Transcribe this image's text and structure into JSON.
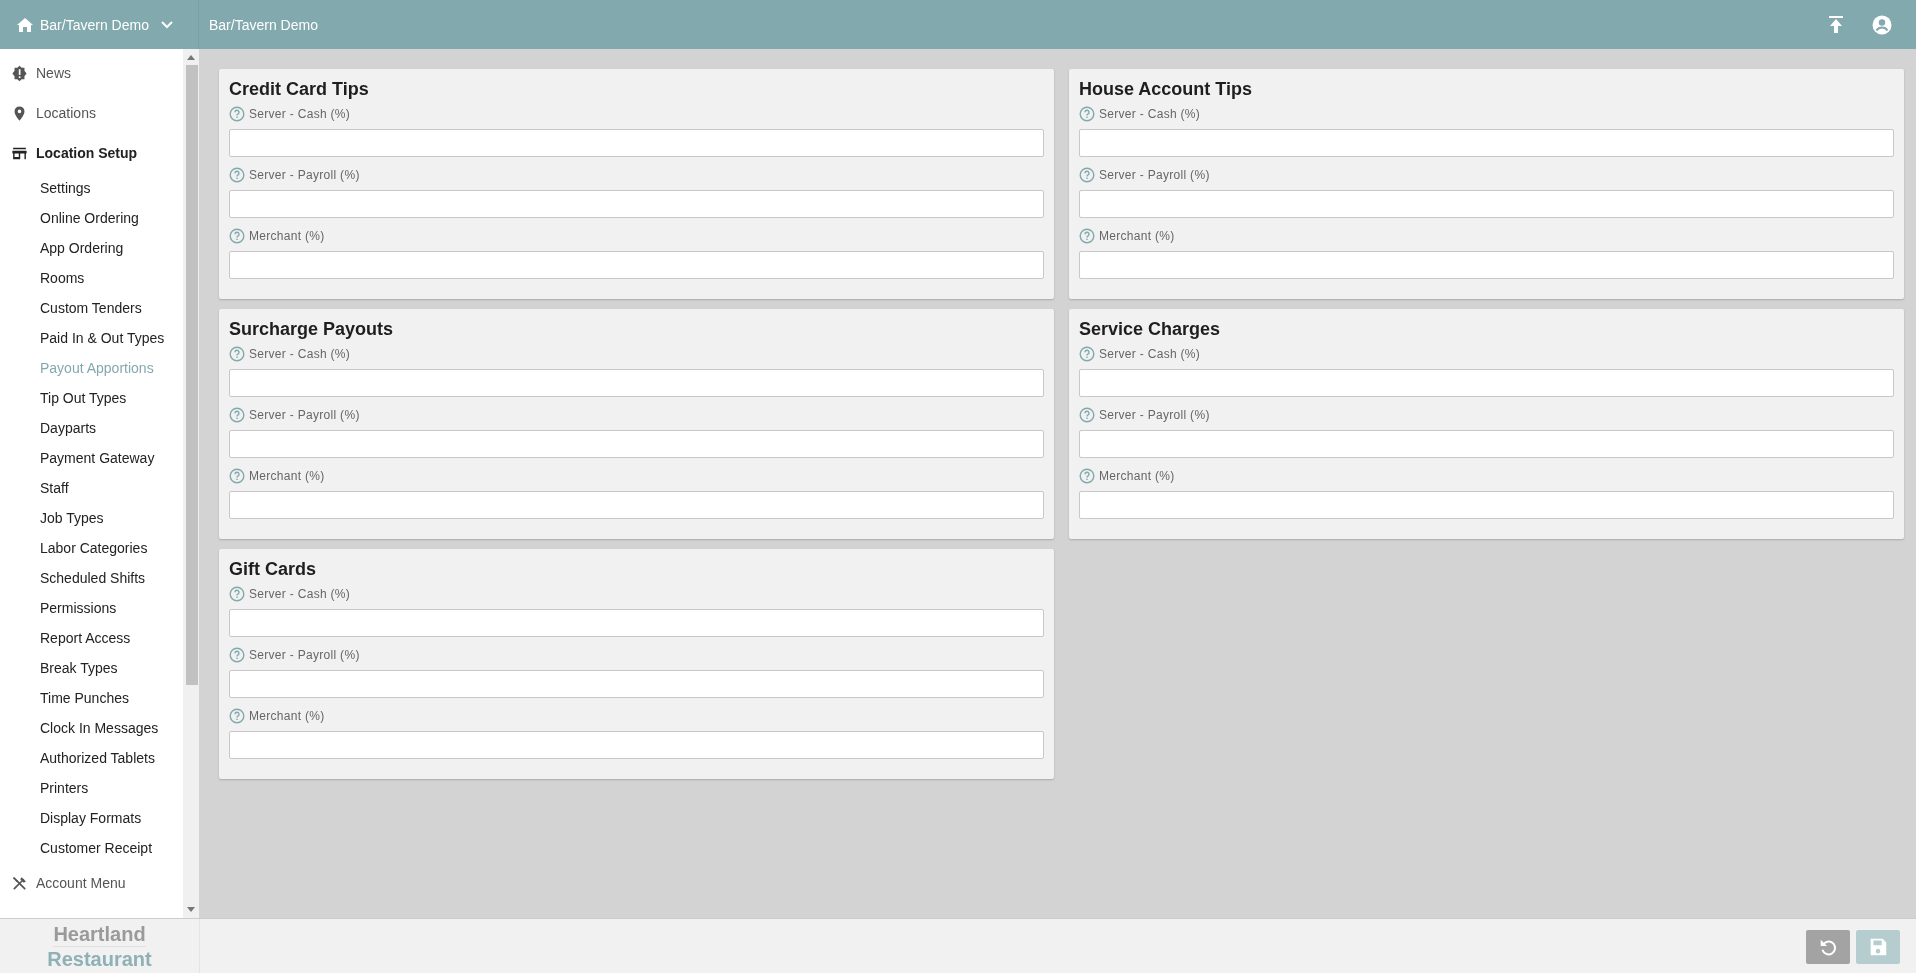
{
  "app_switcher": {
    "label": "Bar/Tavern Demo"
  },
  "header": {
    "title": "Bar/Tavern Demo"
  },
  "sidebar": {
    "items": [
      {
        "label": "News",
        "expanded": false
      },
      {
        "label": "Locations",
        "expanded": false
      },
      {
        "label": "Location Setup",
        "expanded": true,
        "children": [
          {
            "label": "Settings",
            "selected": false
          },
          {
            "label": "Online Ordering",
            "selected": false
          },
          {
            "label": "App Ordering",
            "selected": false
          },
          {
            "label": "Rooms",
            "selected": false
          },
          {
            "label": "Custom Tenders",
            "selected": false
          },
          {
            "label": "Paid In & Out Types",
            "selected": false
          },
          {
            "label": "Payout Apportions",
            "selected": true
          },
          {
            "label": "Tip Out Types",
            "selected": false
          },
          {
            "label": "Dayparts",
            "selected": false
          },
          {
            "label": "Payment Gateway",
            "selected": false
          },
          {
            "label": "Staff",
            "selected": false
          },
          {
            "label": "Job Types",
            "selected": false
          },
          {
            "label": "Labor Categories",
            "selected": false
          },
          {
            "label": "Scheduled Shifts",
            "selected": false
          },
          {
            "label": "Permissions",
            "selected": false
          },
          {
            "label": "Report Access",
            "selected": false
          },
          {
            "label": "Break Types",
            "selected": false
          },
          {
            "label": "Time Punches",
            "selected": false
          },
          {
            "label": "Clock In Messages",
            "selected": false
          },
          {
            "label": "Authorized Tablets",
            "selected": false
          },
          {
            "label": "Printers",
            "selected": false
          },
          {
            "label": "Display Formats",
            "selected": false
          },
          {
            "label": "Customer Receipt",
            "selected": false
          }
        ]
      },
      {
        "label": "Account Menu",
        "expanded": false
      }
    ]
  },
  "cards": [
    {
      "title": "Credit Card Tips",
      "fields": [
        {
          "label": "Server - Cash (%)"
        },
        {
          "label": "Server - Payroll (%)"
        },
        {
          "label": "Merchant (%)"
        }
      ]
    },
    {
      "title": "House Account Tips",
      "fields": [
        {
          "label": "Server - Cash (%)"
        },
        {
          "label": "Server - Payroll (%)"
        },
        {
          "label": "Merchant (%)"
        }
      ]
    },
    {
      "title": "Surcharge Payouts",
      "fields": [
        {
          "label": "Server - Cash (%)"
        },
        {
          "label": "Server - Payroll (%)"
        },
        {
          "label": "Merchant (%)"
        }
      ]
    },
    {
      "title": "Service Charges",
      "fields": [
        {
          "label": "Server - Cash (%)"
        },
        {
          "label": "Server - Payroll (%)"
        },
        {
          "label": "Merchant (%)"
        }
      ]
    },
    {
      "title": "Gift Cards",
      "fields": [
        {
          "label": "Server - Cash (%)"
        },
        {
          "label": "Server - Payroll (%)"
        },
        {
          "label": "Merchant (%)"
        }
      ]
    }
  ],
  "footer": {
    "logo_top": "Heartland",
    "logo_bottom": "Restaurant",
    "buttons": [
      {
        "kind": "undo",
        "disabled": false
      },
      {
        "kind": "save",
        "disabled": true
      }
    ]
  }
}
